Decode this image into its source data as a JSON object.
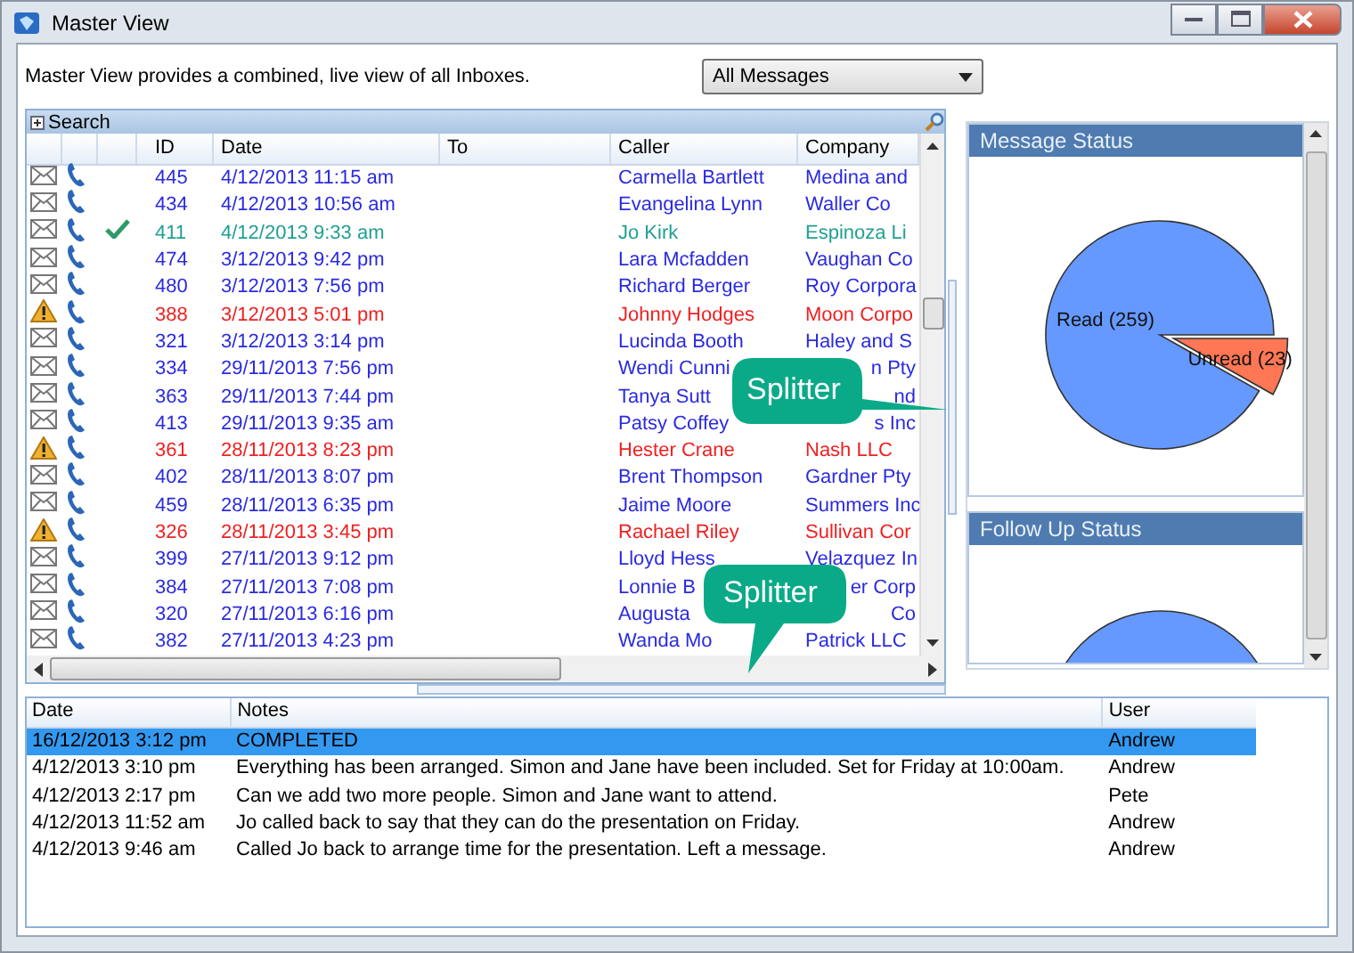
{
  "window": {
    "title": "Master View"
  },
  "description": "Master View provides a combined, live view of all Inboxes.",
  "filter": {
    "value": "All Messages"
  },
  "messages": {
    "search_label": "Search",
    "columns": [
      "ID",
      "Date",
      "To",
      "Caller",
      "Company"
    ],
    "rows": [
      {
        "kind": "normal",
        "id": "445",
        "date": "4/12/2013 11:15 am",
        "caller": "Carmella Bartlett",
        "company": "Medina and"
      },
      {
        "kind": "normal",
        "id": "434",
        "date": "4/12/2013 10:56 am",
        "caller": "Evangelina Lynn",
        "company": "Waller Co"
      },
      {
        "kind": "done",
        "id": "411",
        "date": "4/12/2013 9:33 am",
        "caller": "Jo Kirk",
        "company": "Espinoza Li"
      },
      {
        "kind": "normal",
        "id": "474",
        "date": "3/12/2013 9:42 pm",
        "caller": "Lara Mcfadden",
        "company": "Vaughan Co"
      },
      {
        "kind": "normal",
        "id": "480",
        "date": "3/12/2013 7:56 pm",
        "caller": "Richard Berger",
        "company": "Roy Corpora"
      },
      {
        "kind": "alert",
        "id": "388",
        "date": "3/12/2013 5:01 pm",
        "caller": "Johnny Hodges",
        "company": "Moon Corpo"
      },
      {
        "kind": "normal",
        "id": "321",
        "date": "3/12/2013 3:14 pm",
        "caller": "Lucinda Booth",
        "company": "Haley and S"
      },
      {
        "kind": "normal",
        "id": "334",
        "date": "29/11/2013 7:56 pm",
        "caller": "Wendi Cunni",
        "company": "n Pty",
        "partial": true
      },
      {
        "kind": "normal",
        "id": "363",
        "date": "29/11/2013 7:44 pm",
        "caller": "Tanya Sutt",
        "company": "nd",
        "partial": true
      },
      {
        "kind": "normal",
        "id": "413",
        "date": "29/11/2013 9:35 am",
        "caller": "Patsy Coffey",
        "company": "s Inc",
        "partial": true
      },
      {
        "kind": "alert",
        "id": "361",
        "date": "28/11/2013 8:23 pm",
        "caller": "Hester Crane",
        "company": "Nash LLC"
      },
      {
        "kind": "normal",
        "id": "402",
        "date": "28/11/2013 8:07 pm",
        "caller": "Brent Thompson",
        "company": "Gardner Pty"
      },
      {
        "kind": "normal",
        "id": "459",
        "date": "28/11/2013 6:35 pm",
        "caller": "Jaime Moore",
        "company": "Summers Inc"
      },
      {
        "kind": "alert",
        "id": "326",
        "date": "28/11/2013 3:45 pm",
        "caller": "Rachael Riley",
        "company": "Sullivan Cor"
      },
      {
        "kind": "normal",
        "id": "399",
        "date": "27/11/2013 9:12 pm",
        "caller": "Lloyd Hess",
        "company": "Velazquez In"
      },
      {
        "kind": "normal",
        "id": "384",
        "date": "27/11/2013 7:08 pm",
        "caller": "Lonnie B",
        "company": "er Corp",
        "partial": true
      },
      {
        "kind": "normal",
        "id": "320",
        "date": "27/11/2013 6:16 pm",
        "caller": "Augusta",
        "company": "Co",
        "partial": true
      },
      {
        "kind": "normal",
        "id": "382",
        "date": "27/11/2013 4:23 pm",
        "caller": "Wanda Mo",
        "company": "Patrick LLC"
      }
    ]
  },
  "message_status": {
    "title": "Message Status",
    "chart_data": {
      "type": "pie",
      "categories": [
        "Read",
        "Unread"
      ],
      "values": [
        259,
        23
      ],
      "value_labels": [
        "(259)",
        "(23)"
      ]
    }
  },
  "follow_up_status": {
    "title": "Follow Up Status"
  },
  "notes": {
    "columns": [
      "Date",
      "Notes",
      "User"
    ],
    "rows": [
      {
        "selected": true,
        "date": "16/12/2013 3:12 pm",
        "note": "COMPLETED",
        "user": "Andrew"
      },
      {
        "selected": false,
        "date": "4/12/2013 3:10 pm",
        "note": "Everything has been arranged.  Simon and Jane have been included.  Set for Friday at 10:00am.",
        "user": "Andrew"
      },
      {
        "selected": false,
        "date": "4/12/2013 2:17 pm",
        "note": "Can we add two more people. Simon and Jane want to attend.",
        "user": "Pete"
      },
      {
        "selected": false,
        "date": "4/12/2013 11:52 am",
        "note": "Jo called back to say that they can do the presentation on Friday.",
        "user": "Andrew"
      },
      {
        "selected": false,
        "date": "4/12/2013 9:46 am",
        "note": "Called Jo back to arrange time for the presentation. Left a message.",
        "user": "Andrew"
      }
    ]
  },
  "callouts": [
    {
      "text": "Splitter"
    },
    {
      "text": "Splitter"
    }
  ]
}
